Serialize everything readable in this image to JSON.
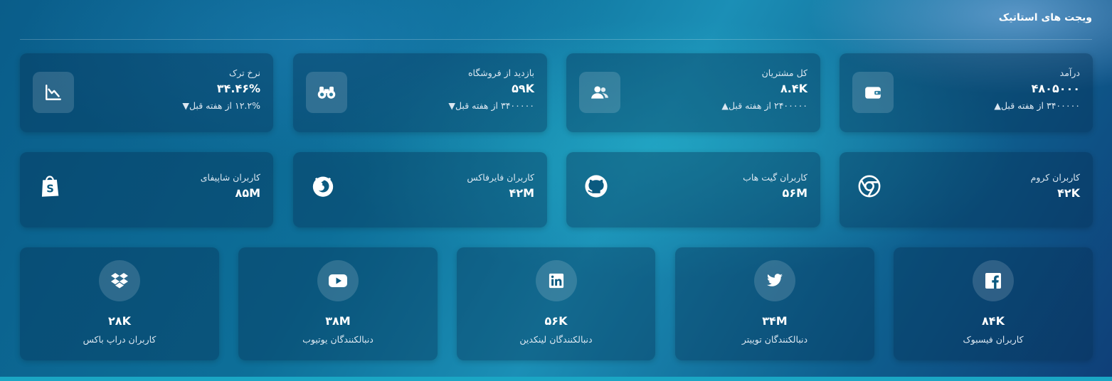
{
  "page": {
    "title": "ویجت های استاتیک"
  },
  "stats": [
    {
      "label": "درآمد",
      "value": "۴۸۰۵۰۰۰",
      "change": "۳۴۰۰۰۰۰ از هفته قبل",
      "arrow": "▲",
      "icon": "wallet-icon"
    },
    {
      "label": "کل مشتریان",
      "value": "۸.۴K",
      "change": "۲۴۰۰۰۰۰ از هفته قبل",
      "arrow": "▲",
      "icon": "users-icon"
    },
    {
      "label": "بازدید از فروشگاه",
      "value": "۵۹K",
      "change": "۳۴۰۰۰۰۰ از هفته قبل",
      "arrow": "▼",
      "icon": "binoculars-icon"
    },
    {
      "label": "نرخ ترک",
      "value": "۳۴.۴۶%",
      "change": "۱۲.۲% از هفته قبل",
      "arrow": "▼",
      "icon": "chart-down-icon"
    }
  ],
  "users": [
    {
      "label": "کاربران کروم",
      "value": "۴۲K",
      "icon": "chrome-icon"
    },
    {
      "label": "کاربران گیت هاب",
      "value": "۵۶M",
      "icon": "github-icon"
    },
    {
      "label": "کاربران فایرفاکس",
      "value": "۴۲M",
      "icon": "firefox-icon"
    },
    {
      "label": "کاربران شاپیفای",
      "value": "۸۵M",
      "icon": "shopify-icon"
    }
  ],
  "social": [
    {
      "label": "کاربران فیسبوک",
      "value": "۸۴K",
      "icon": "facebook-icon"
    },
    {
      "label": "دنبالکنندگان توییتر",
      "value": "۳۴M",
      "icon": "twitter-icon"
    },
    {
      "label": "دنبالکنندگان لینکدین",
      "value": "۵۶K",
      "icon": "linkedin-icon"
    },
    {
      "label": "دنبالکنندگان یوتیوب",
      "value": "۳۸M",
      "icon": "youtube-icon"
    },
    {
      "label": "کاربران دراپ باکس",
      "value": "۲۸K",
      "icon": "dropbox-icon"
    }
  ]
}
